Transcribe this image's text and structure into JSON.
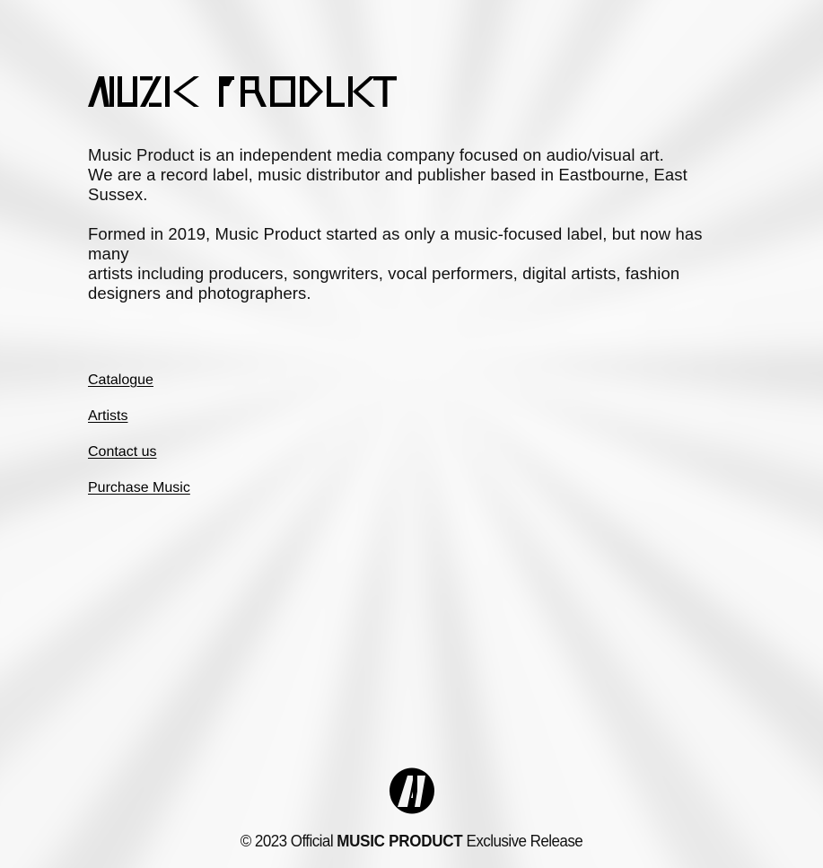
{
  "header": {
    "logo_text": "MUSIC PRODUCT",
    "logo_alt": "MUSIC PRODUCT"
  },
  "intro": {
    "paragraph1_line1": "Music Product is an independent media company focused on audio/visual art.",
    "paragraph1_line2": "We are a record label, music distributor and publisher based in Eastbourne, East Sussex.",
    "paragraph2_line1": "Formed in 2019, Music Product started as only a music-focused label, but now has many",
    "paragraph2_line2": "artists including producers, songwriters, vocal performers, digital artists, fashion designers and photographers."
  },
  "nav": {
    "items": [
      {
        "label": "Catalogue"
      },
      {
        "label": "Artists"
      },
      {
        "label": "Contact us"
      },
      {
        "label": "Purchase Music"
      }
    ]
  },
  "footer": {
    "copyright_prefix": "© 2023 Official ",
    "brand": "MUSIC PRODUCT",
    "suffix": " Exclusive Release",
    "logo_icon": "m-circle-logo-icon"
  },
  "colors": {
    "text": "#111111",
    "background": "#f3f3f3"
  }
}
